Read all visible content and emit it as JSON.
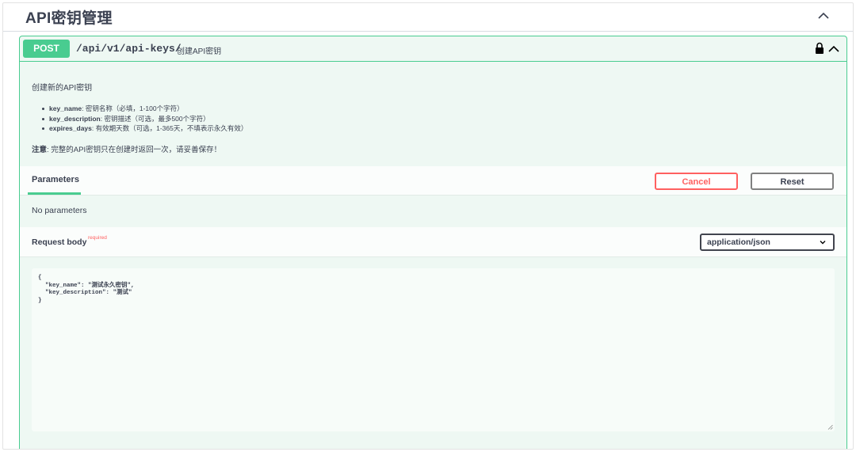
{
  "section": {
    "title": "API密钥管理"
  },
  "operation": {
    "method": "POST",
    "path": "/api/v1/api-keys/",
    "summary": "创建API密钥",
    "description": {
      "intro": "创建新的API密钥",
      "params": [
        {
          "name": "key_name",
          "text": ": 密钥名称（必填，1-100个字符）"
        },
        {
          "name": "key_description",
          "text": ": 密钥描述（可选，最多500个字符）"
        },
        {
          "name": "expires_days",
          "text": ": 有效期天数（可选，1-365天，不填表示永久有效）"
        }
      ],
      "note_label": "注意",
      "note_text": ": 完整的API密钥只在创建时返回一次，请妥善保存！"
    }
  },
  "parameters": {
    "tab_label": "Parameters",
    "cancel_label": "Cancel",
    "reset_label": "Reset",
    "empty_text": "No parameters"
  },
  "request_body": {
    "label": "Request body",
    "required_label": "required",
    "content_type": "application/json",
    "body": "{\n  \"key_name\": \"测试永久密钥\",\n  \"key_description\": \"测试\"\n}"
  },
  "colors": {
    "post_accent": "#49cc90",
    "cancel_red": "#ff6060"
  }
}
